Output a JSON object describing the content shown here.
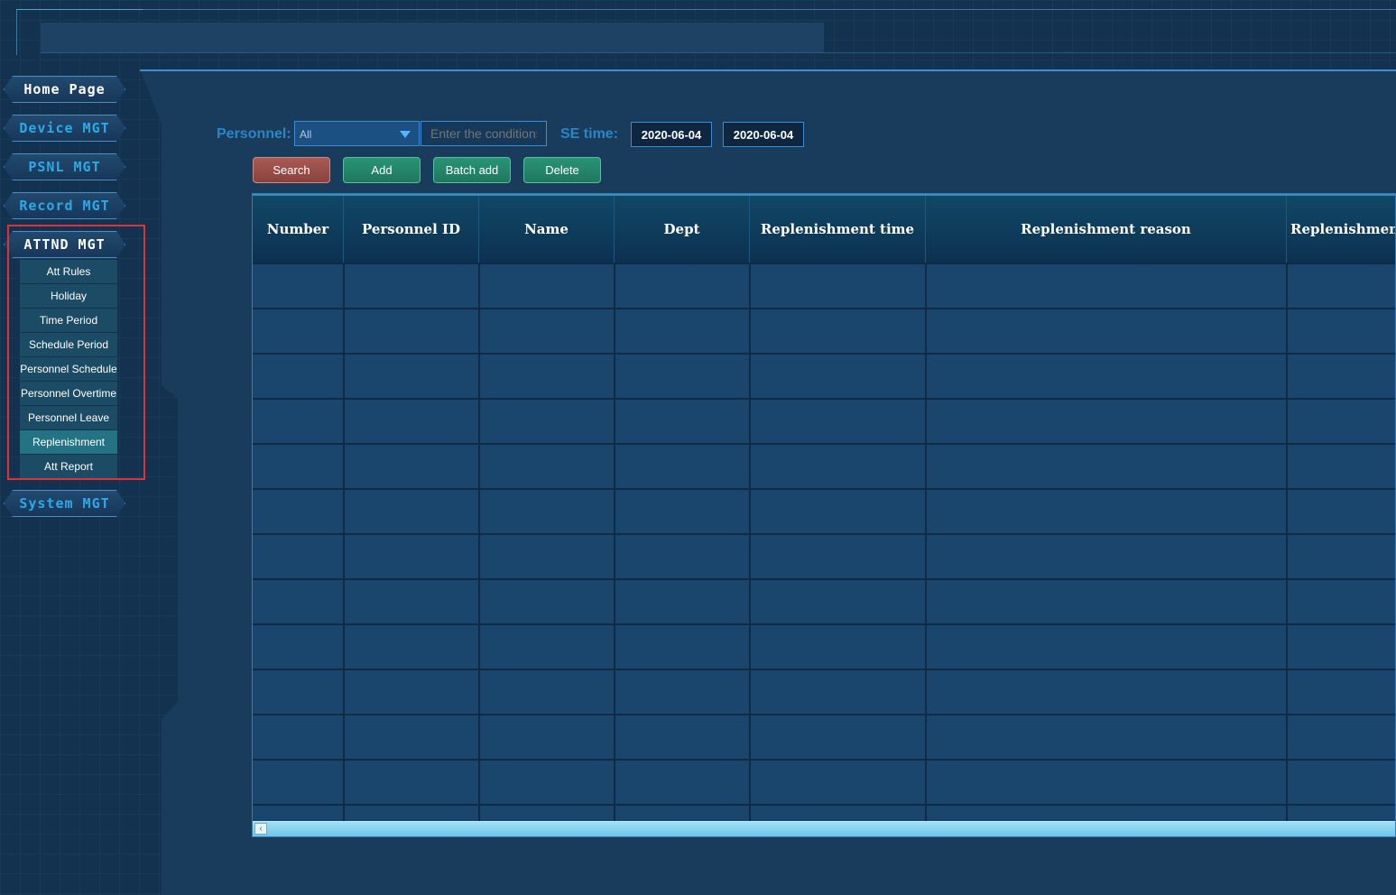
{
  "nav": {
    "home": "Home Page",
    "device": "Device MGT",
    "psnl": "PSNL MGT",
    "record": "Record MGT",
    "attnd": "ATTND MGT",
    "system": "System MGT",
    "submenu": [
      "Att Rules",
      "Holiday",
      "Time Period",
      "Schedule Period",
      "Personnel Schedule",
      "Personnel Overtime",
      "Personnel Leave",
      "Replenishment",
      "Att Report"
    ]
  },
  "filters": {
    "personnel_label": "Personnel:",
    "personnel_value": "All",
    "condition_placeholder": "Enter the conditions",
    "se_time_label": "SE time:",
    "start_date": "2020-06-04",
    "end_date": "2020-06-04"
  },
  "toolbar": {
    "search": "Search",
    "add": "Add",
    "batch_add": "Batch add",
    "delete": "Delete"
  },
  "table": {
    "headers": [
      "Number",
      "Personnel ID",
      "Name",
      "Dept",
      "Replenishment time",
      "Replenishment reason",
      "Replenishmen"
    ]
  },
  "colors": {
    "accent_blue": "#2fa8e8",
    "highlight_red": "#e0303a",
    "search_button": "#a85a54",
    "action_button": "#2a9475"
  }
}
